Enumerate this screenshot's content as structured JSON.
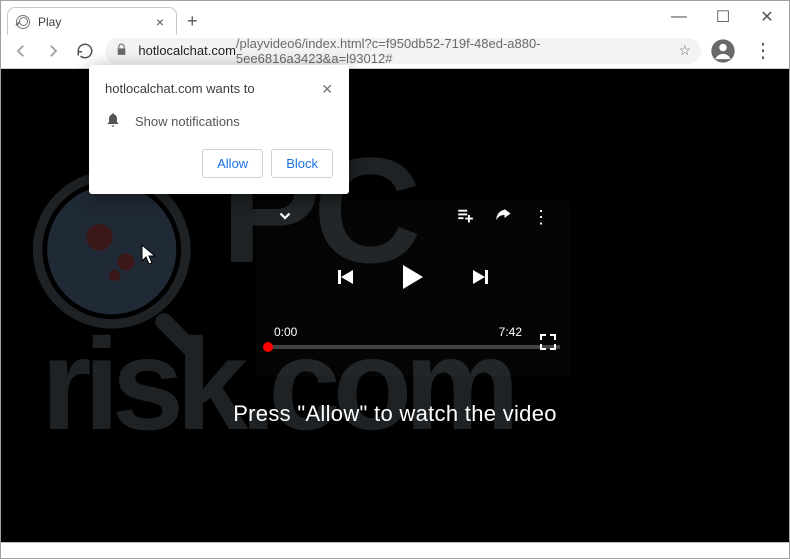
{
  "tab": {
    "title": "Play",
    "close": "×"
  },
  "new_tab": "+",
  "nav": {
    "url_host": "hotlocalchat.com",
    "url_path": "/playvideo6/index.html?c=f950db52-719f-48ed-a880-5ee6816a3423&a=l93012#"
  },
  "permission": {
    "title": "hotlocalchat.com wants to",
    "item": "Show notifications",
    "allow": "Allow",
    "block": "Block"
  },
  "player": {
    "current_time": "0:00",
    "duration": "7:42"
  },
  "page": {
    "instruction": "Press \"Allow\" to watch the video"
  },
  "icons": {
    "window_min": "—",
    "window_max": "☐",
    "window_close": "✕"
  }
}
